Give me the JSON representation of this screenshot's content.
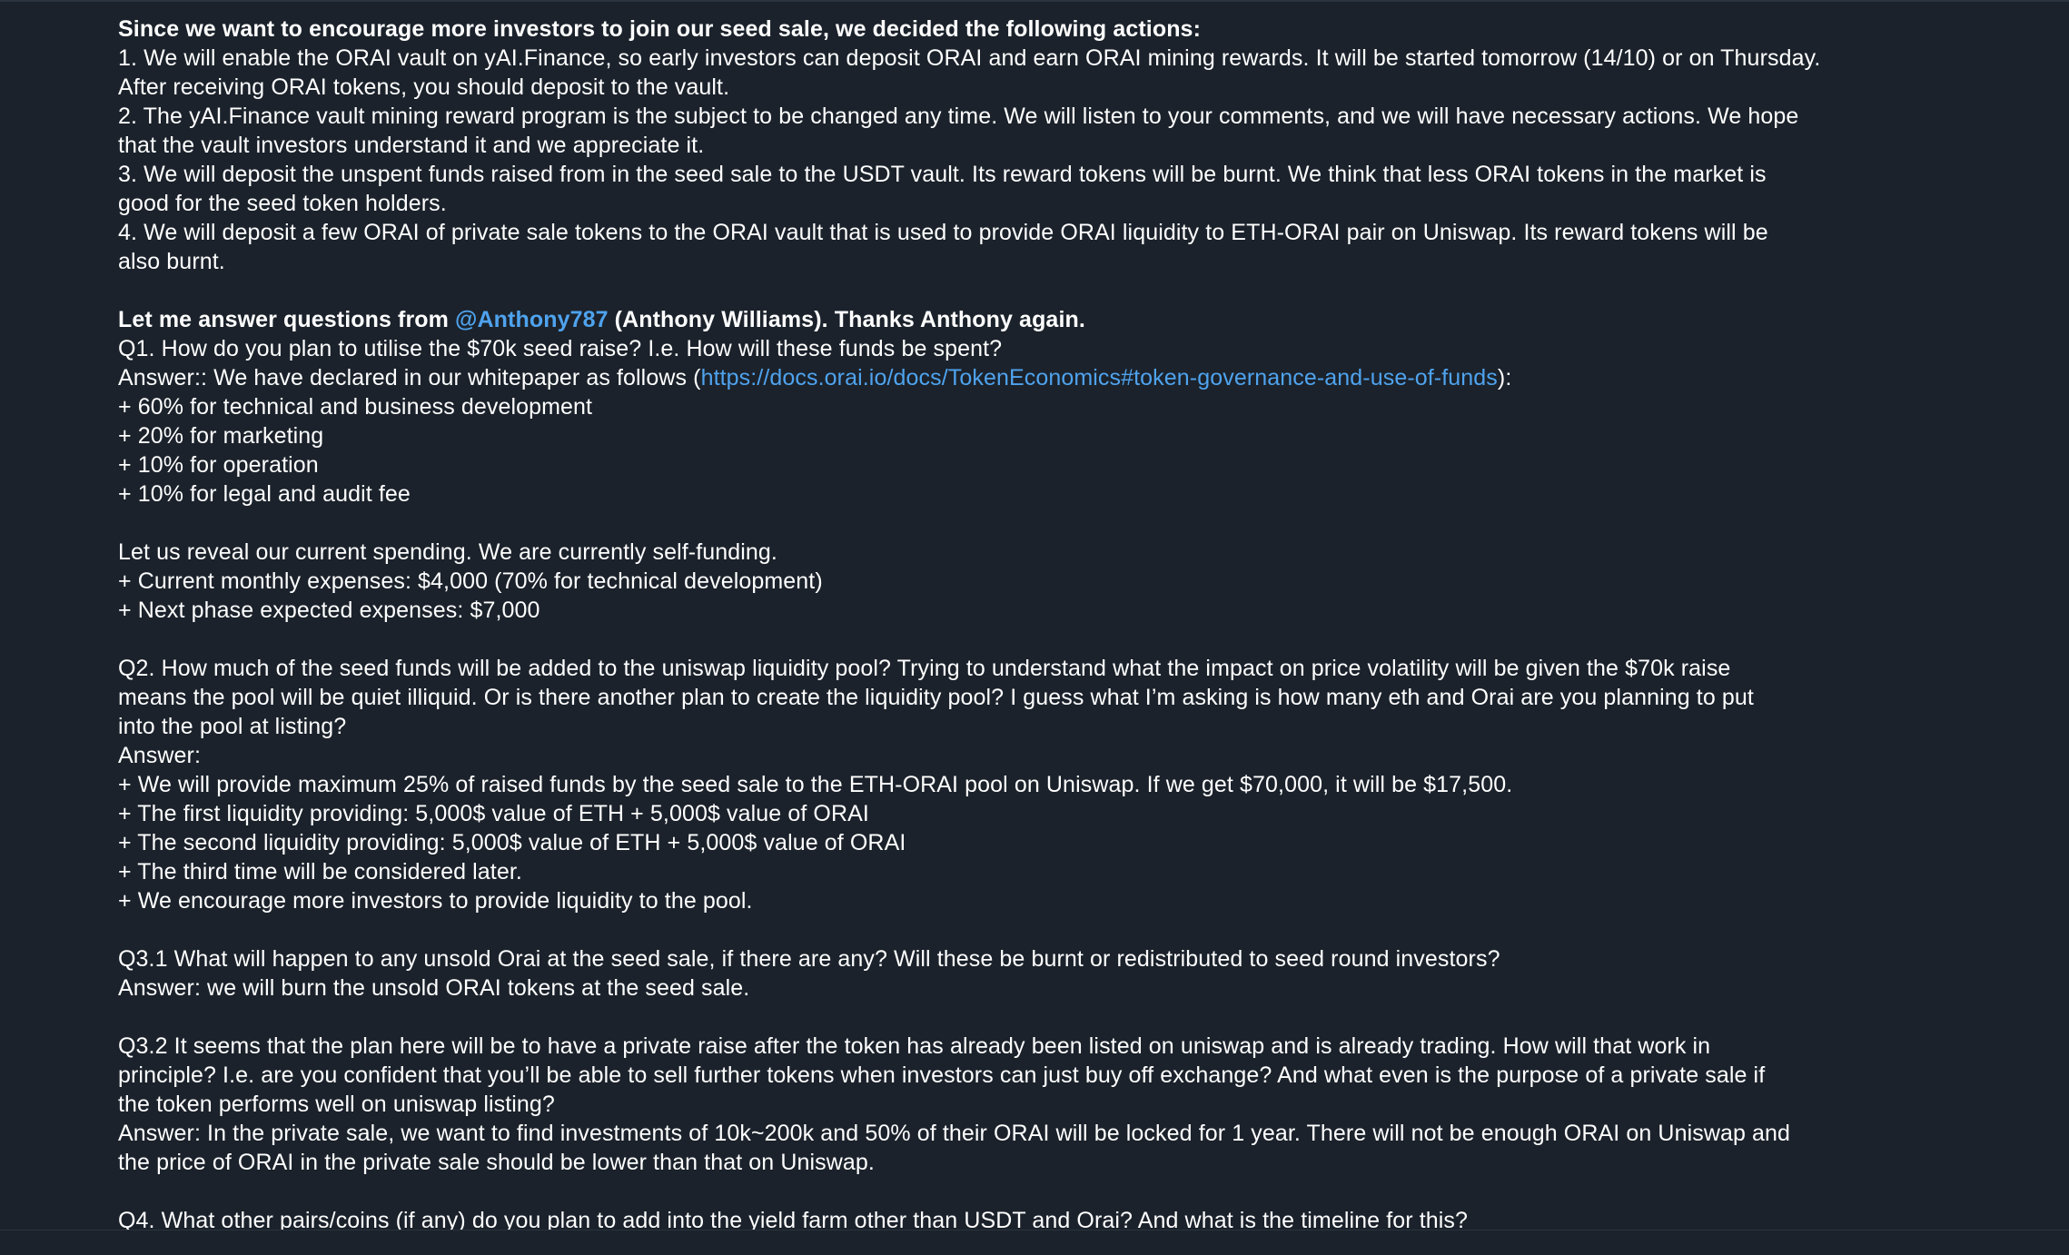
{
  "message": {
    "intro_heading": "Since we want to encourage more investors to join our seed sale, we decided the following actions:",
    "actions": [
      "1. We will enable the ORAI vault on yAI.Finance, so early investors can deposit ORAI and earn ORAI mining rewards. It will be started tomorrow (14/10) or on Thursday.",
      "After receiving ORAI tokens, you should deposit to the vault.",
      "2. The yAI.Finance vault mining reward program is the subject to be changed any time. We will listen to your comments, and we will have necessary actions. We hope",
      "that the vault investors understand it and we appreciate it.",
      "3. We will deposit the unspent funds raised from in the seed sale to the USDT vault. Its reward tokens will be burnt. We think that less ORAI tokens in the market is",
      "good for the seed token holders.",
      "4. We will deposit a few ORAI of private sale tokens to the ORAI vault that is used to provide ORAI liquidity to ETH-ORAI pair on Uniswap. Its reward tokens will be",
      "also burnt."
    ],
    "answer_heading_pre": "Let me answer questions from ",
    "mention": "@Anthony787",
    "answer_heading_post": " (Anthony Williams). Thanks Anthony again.",
    "q1": "Q1. How do you plan to utilise the $70k seed raise? I.e. How will these funds be spent?",
    "a1_pre": "Answer:: We have declared in our whitepaper as follows (",
    "a1_link": "https://docs.orai.io/docs/TokenEconomics#token-governance-and-use-of-funds",
    "a1_post": "):",
    "a1_items": [
      "+ 60% for technical and business development",
      "+ 20% for marketing",
      "+ 10% for operation",
      "+ 10% for legal and audit fee"
    ],
    "spending": [
      "Let us reveal our current spending. We are currently self-funding.",
      "+ Current monthly expenses: $4,000 (70% for technical development)",
      "+ Next phase expected expenses: $7,000"
    ],
    "q2": [
      "Q2. How much of the seed funds will be added to the uniswap liquidity pool? Trying to understand what the impact on price volatility will be given the $70k raise",
      "means the pool will be quiet illiquid. Or is there another plan to create the liquidity pool? I guess what I’m asking is how many eth and Orai are you planning to put",
      "into the pool at listing?",
      "Answer:",
      "+ We will provide maximum 25% of raised funds by the seed sale to the ETH-ORAI pool on Uniswap. If we get $70,000, it will be $17,500.",
      "+ The first liquidity providing: 5,000$ value of ETH + 5,000$ value of ORAI",
      "+ The second liquidity providing: 5,000$ value of ETH + 5,000$ value of ORAI",
      "+ The third time will be considered later.",
      "+ We encourage more investors to provide liquidity to the pool."
    ],
    "q31": [
      "Q3.1 What will happen to any unsold Orai at the seed sale, if there are any? Will these be burnt or redistributed to seed round investors?",
      "Answer: we will burn the unsold ORAI tokens at the seed sale."
    ],
    "q32": [
      "Q3.2 It seems that the plan here will be to have a private raise after the token has already been listed on uniswap and is already trading. How will that work in",
      "principle? I.e. are you confident that you’ll be able to sell further tokens when investors can just buy off exchange? And what even is the purpose of a private sale if",
      "the token performs well on uniswap listing?",
      "Answer: In the private sale, we want to find investments of 10k~200k and 50% of their ORAI will be locked for 1 year. There will not be enough ORAI on Uniswap and",
      "the price of ORAI in the private sale should be lower than that on Uniswap."
    ],
    "q4": "Q4. What other pairs/coins (if any) do you plan to add into the yield farm other than USDT and Orai? And what is the timeline for this?"
  },
  "colors": {
    "background": "#1b222b",
    "text": "#ffffff",
    "link": "#4fa3ee"
  }
}
